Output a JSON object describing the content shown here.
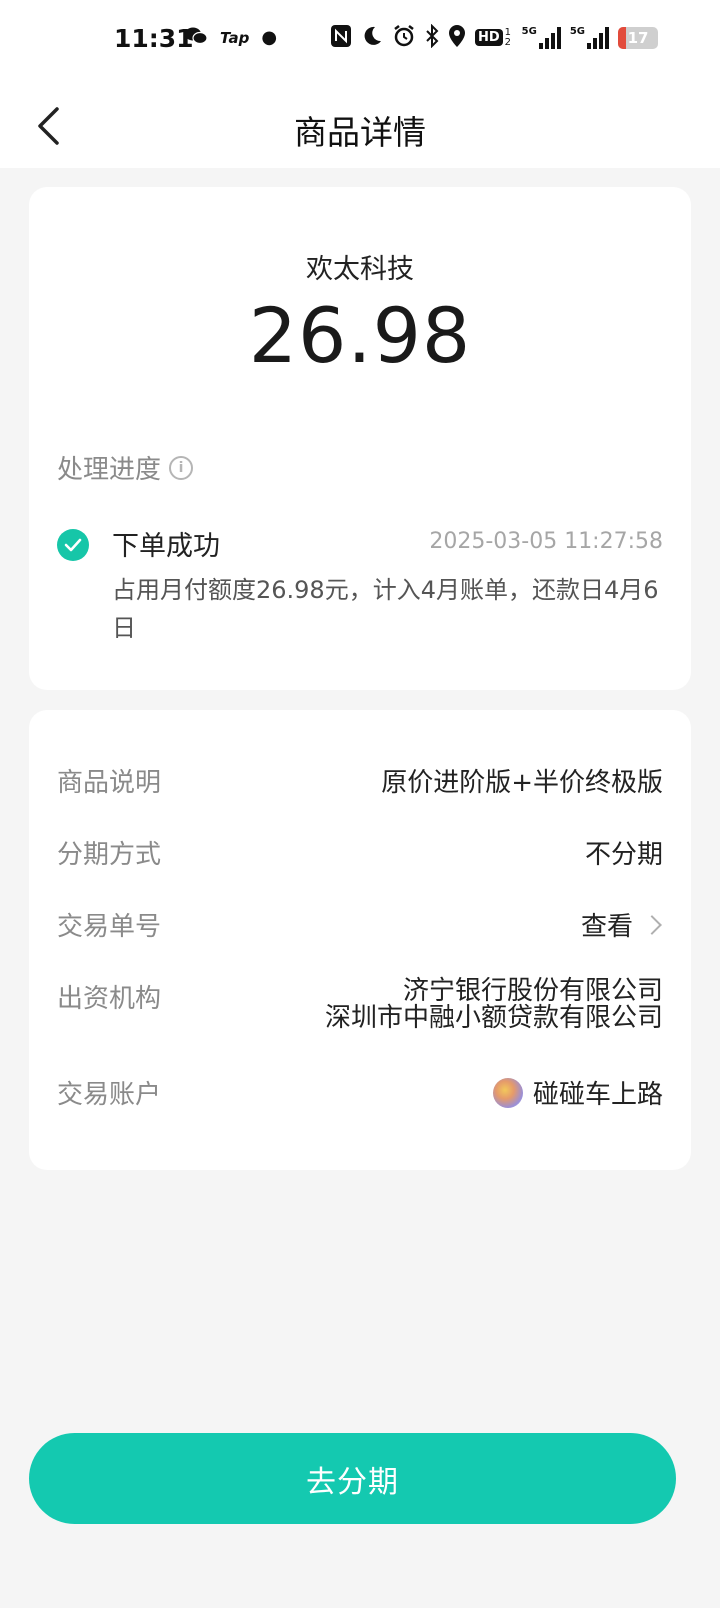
{
  "status_bar": {
    "time": "11:31",
    "left_icons": [
      "wechat-icon",
      "taptap-icon",
      "dot-icon"
    ],
    "tap_label": "Tap",
    "right_icons": [
      "nfc-icon",
      "moon-icon",
      "alarm-icon",
      "bluetooth-icon",
      "location-icon",
      "hd-icon",
      "signal-5g-icon",
      "signal-5g-icon",
      "battery-icon"
    ],
    "hd_label": "HD",
    "hd_sub": "1 2",
    "net1_label": "5G",
    "net2_label": "5G",
    "battery_level": "17",
    "battery_color": "#e24b3b"
  },
  "nav": {
    "title": "商品详情",
    "back_icon": "chevron-left-icon"
  },
  "order_card": {
    "merchant": "欢太科技",
    "amount": "26.98",
    "progress_label": "处理进度",
    "steps": [
      {
        "title": "下单成功",
        "time": "2025-03-05 11:27:58",
        "desc": "占用月付额度26.98元，计入4月账单，还款日4月6日",
        "status_color": "#16c6a8"
      }
    ]
  },
  "details_card": {
    "rows": [
      {
        "label": "商品说明",
        "value": "原价进阶版+半价终极版"
      },
      {
        "label": "分期方式",
        "value": "不分期"
      },
      {
        "label": "交易单号",
        "value": "查看"
      },
      {
        "label": "出资机构",
        "value_lines": [
          "济宁银行股份有限公司",
          "深圳市中融小额贷款有限公司"
        ]
      },
      {
        "label": "交易账户",
        "value": "碰碰车上路"
      }
    ]
  },
  "cta": {
    "label": "去分期",
    "color": "#14c9b0"
  }
}
